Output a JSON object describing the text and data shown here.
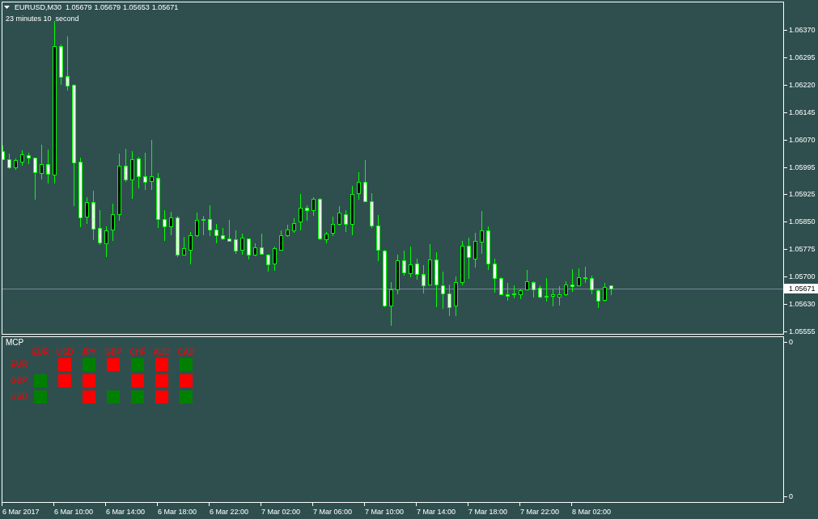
{
  "chart": {
    "header": {
      "symbol": "EURUSD,M30",
      "ohlc": [
        "1.05679",
        "1.05679",
        "1.05653",
        "1.05671"
      ]
    },
    "timer": "23 minutes 10  second",
    "price_axis": {
      "labels": [
        "1.06370",
        "1.06295",
        "1.06220",
        "1.06145",
        "1.06070",
        "1.05995",
        "1.05925",
        "1.05850",
        "1.05775",
        "1.05700",
        "1.05630",
        "1.05555"
      ],
      "current_price": "1.05671"
    },
    "time_axis": {
      "labels": [
        "6 Mar 2017",
        "6 Mar 10:00",
        "6 Mar 14:00",
        "6 Mar 18:00",
        "6 Mar 22:00",
        "7 Mar 02:00",
        "7 Mar 06:00",
        "7 Mar 10:00",
        "7 Mar 14:00",
        "7 Mar 18:00",
        "7 Mar 22:00",
        "8 Mar 02:00"
      ]
    }
  },
  "indicator": {
    "name": "MCP",
    "columns": [
      "EUR",
      "USD",
      "JPY",
      "GBP",
      "CHF",
      "AUD",
      "CAD"
    ],
    "rows": [
      {
        "label": "EUR",
        "cells": [
          {
            "kind": "empty"
          },
          {
            "kind": "square",
            "color": "#ff0000"
          },
          {
            "kind": "square",
            "color": "#008000"
          },
          {
            "kind": "square",
            "color": "#ff0000"
          },
          {
            "kind": "square",
            "color": "#008000"
          },
          {
            "kind": "square",
            "color": "#ff0000"
          },
          {
            "kind": "square",
            "color": "#008000"
          }
        ]
      },
      {
        "label": "GBP",
        "cells": [
          {
            "kind": "square",
            "color": "#008000"
          },
          {
            "kind": "square",
            "color": "#ff0000"
          },
          {
            "kind": "square",
            "color": "#ff0000"
          },
          {
            "kind": "empty"
          },
          {
            "kind": "square",
            "color": "#ff0000"
          },
          {
            "kind": "square",
            "color": "#ff0000"
          },
          {
            "kind": "square",
            "color": "#ff0000"
          }
        ]
      },
      {
        "label": "USD",
        "cells": [
          {
            "kind": "square",
            "color": "#008000"
          },
          {
            "kind": "empty"
          },
          {
            "kind": "square",
            "color": "#ff0000"
          },
          {
            "kind": "square",
            "color": "#008000"
          },
          {
            "kind": "square",
            "color": "#008000"
          },
          {
            "kind": "square",
            "color": "#ff0000"
          },
          {
            "kind": "square",
            "color": "#008000"
          }
        ]
      }
    ],
    "scale_labels": [
      "0",
      "0"
    ]
  }
}
